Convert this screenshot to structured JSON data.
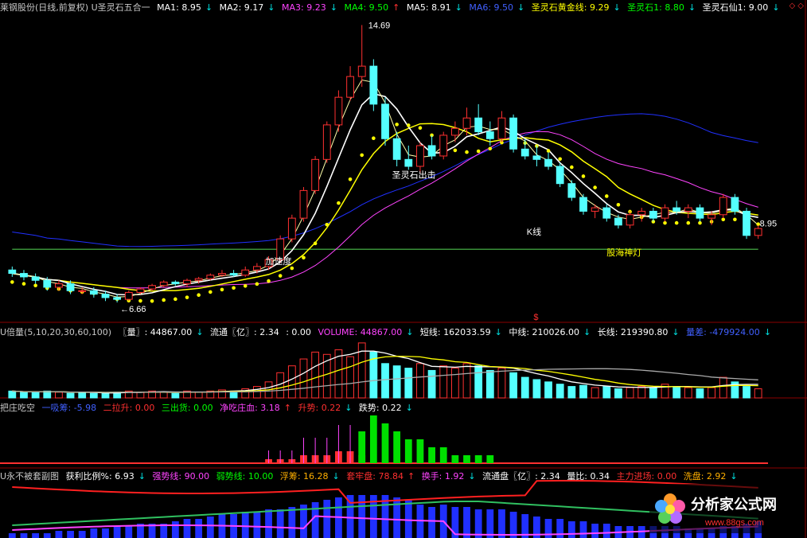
{
  "colors": {
    "bg": "#000000",
    "axis": "#8b0000",
    "up": "#ff3030",
    "down": "#54ffff",
    "white": "#ffffff",
    "yellow": "#ffff00",
    "magenta": "#ff44ff",
    "green": "#4cbf4c",
    "blue": "#2030ff",
    "cyan": "#00e0e0"
  },
  "header": {
    "title": "莱钢股份(日线,前复权) U圣灵石五合一",
    "ma1": "MA1: 8.95",
    "ma2": "MA2: 9.17",
    "ma3": "MA3: 9.23",
    "ma4": "MA4: 9.50",
    "ma5": "MA5: 8.91",
    "ma6": "MA6: 9.50",
    "gold": "圣灵石黄金线: 9.29",
    "stone1": "圣灵石1: 8.80",
    "immortal1": "圣灵石仙1: 9.00"
  },
  "annotations": {
    "high": "14.69",
    "low": "←6.66",
    "last": "8.95",
    "signal_sell": "圣灵石出击",
    "signal_accel": "加速度",
    "signal_k": "K线",
    "signal_lamp": "股海神灯",
    "marker": "$"
  },
  "panel2": {
    "title": "U倍量(5,10,20,30,60,100)",
    "vol": "〖量〗: 44867.00",
    "float": "流通〖亿〗: 2.34",
    "zero": ": 0.00",
    "volume": "VOLUME: 44867.00",
    "short": "短线: 162033.59",
    "mid": "中线: 210026.00",
    "long": "长线: 219390.80",
    "diff": "量差: -479924.00"
  },
  "panel3": {
    "title": "把庄吃空",
    "a": "一吸筹: -5.98",
    "b": "二拉升: 0.00",
    "c": "三出货: 0.00",
    "d": "净吃庄血: 3.18",
    "e": "升势: 0.22",
    "f": "跌势: 0.22"
  },
  "panel4": {
    "title": "U永不被套副图",
    "a": "获利比例%: 6.93",
    "b": "强势线: 90.00",
    "c": "弱势线: 10.00",
    "d": "浮筹: 16.28",
    "e": "套牢盘: 78.84",
    "f": "换手: 1.92",
    "g": "流通盘〖亿〗: 2.34",
    "h": "量比: 0.34",
    "i": "主力进场: 0.00",
    "j": "洗盘: 2.92"
  },
  "watermark": {
    "name": "分析家公式网",
    "url": "www.88gs.com"
  },
  "chart_data": {
    "type": "candlestick",
    "price_range": [
      6.2,
      15.0
    ],
    "candles": [
      [
        7.6,
        7.7,
        7.4,
        7.5
      ],
      [
        7.5,
        7.6,
        7.3,
        7.4
      ],
      [
        7.4,
        7.5,
        7.2,
        7.3
      ],
      [
        7.3,
        7.4,
        7.0,
        7.1
      ],
      [
        7.1,
        7.3,
        7.0,
        7.2
      ],
      [
        7.2,
        7.3,
        6.9,
        7.0
      ],
      [
        7.0,
        7.1,
        6.9,
        7.0
      ],
      [
        7.0,
        7.1,
        6.8,
        6.9
      ],
      [
        6.9,
        7.0,
        6.7,
        6.8
      ],
      [
        6.8,
        6.9,
        6.66,
        6.75
      ],
      [
        6.75,
        7.0,
        6.7,
        6.95
      ],
      [
        6.95,
        7.1,
        6.9,
        7.05
      ],
      [
        7.05,
        7.2,
        7.0,
        7.15
      ],
      [
        7.15,
        7.3,
        7.1,
        7.25
      ],
      [
        7.25,
        7.3,
        7.15,
        7.2
      ],
      [
        7.2,
        7.35,
        7.1,
        7.3
      ],
      [
        7.3,
        7.4,
        7.2,
        7.35
      ],
      [
        7.35,
        7.5,
        7.3,
        7.45
      ],
      [
        7.45,
        7.6,
        7.4,
        7.5
      ],
      [
        7.5,
        7.6,
        7.4,
        7.45
      ],
      [
        7.45,
        7.7,
        7.4,
        7.6
      ],
      [
        7.6,
        7.8,
        7.5,
        7.7
      ],
      [
        7.7,
        8.0,
        7.6,
        7.9
      ],
      [
        7.9,
        8.6,
        7.8,
        8.5
      ],
      [
        8.5,
        9.2,
        8.4,
        9.1
      ],
      [
        9.1,
        10.0,
        9.0,
        9.9
      ],
      [
        9.9,
        10.9,
        9.8,
        10.8
      ],
      [
        10.8,
        11.9,
        10.7,
        11.8
      ],
      [
        11.8,
        12.8,
        11.6,
        12.6
      ],
      [
        12.6,
        13.5,
        12.5,
        13.2
      ],
      [
        13.2,
        14.69,
        12.9,
        13.5
      ],
      [
        13.5,
        13.7,
        12.2,
        12.4
      ],
      [
        12.4,
        12.6,
        11.2,
        11.4
      ],
      [
        11.4,
        11.6,
        10.6,
        10.8
      ],
      [
        10.8,
        11.2,
        10.5,
        10.6
      ],
      [
        10.6,
        11.3,
        10.4,
        11.2
      ],
      [
        11.2,
        11.5,
        10.8,
        10.9
      ],
      [
        10.9,
        11.6,
        10.8,
        11.5
      ],
      [
        11.5,
        11.9,
        11.3,
        11.7
      ],
      [
        11.7,
        12.3,
        11.5,
        12.0
      ],
      [
        12.0,
        12.4,
        11.5,
        11.6
      ],
      [
        11.6,
        11.9,
        11.2,
        11.4
      ],
      [
        11.4,
        12.2,
        11.3,
        12.0
      ],
      [
        12.0,
        12.1,
        11.0,
        11.1
      ],
      [
        11.1,
        11.4,
        10.8,
        10.9
      ],
      [
        10.9,
        11.2,
        10.6,
        10.8
      ],
      [
        10.8,
        11.0,
        10.5,
        10.6
      ],
      [
        10.6,
        10.7,
        10.0,
        10.1
      ],
      [
        10.1,
        10.2,
        9.6,
        9.7
      ],
      [
        9.7,
        9.8,
        9.2,
        9.3
      ],
      [
        9.3,
        9.5,
        9.1,
        9.4
      ],
      [
        9.4,
        9.5,
        9.0,
        9.1
      ],
      [
        9.1,
        9.2,
        8.8,
        8.9
      ],
      [
        8.9,
        9.3,
        8.8,
        9.2
      ],
      [
        9.2,
        9.4,
        9.0,
        9.3
      ],
      [
        9.3,
        9.4,
        9.0,
        9.1
      ],
      [
        9.1,
        9.5,
        9.0,
        9.4
      ],
      [
        9.4,
        9.6,
        9.2,
        9.3
      ],
      [
        9.3,
        9.5,
        9.1,
        9.4
      ],
      [
        9.4,
        9.5,
        9.0,
        9.1
      ],
      [
        9.1,
        9.3,
        8.9,
        9.2
      ],
      [
        9.2,
        9.8,
        9.1,
        9.7
      ],
      [
        9.7,
        9.8,
        9.2,
        9.3
      ],
      [
        9.3,
        9.4,
        8.5,
        8.6
      ],
      [
        8.6,
        8.9,
        8.5,
        8.8
      ]
    ],
    "volume": [
      6,
      5,
      5,
      6,
      5,
      4,
      5,
      4,
      4,
      5,
      6,
      5,
      6,
      5,
      4,
      6,
      5,
      6,
      7,
      6,
      8,
      10,
      14,
      22,
      28,
      34,
      40,
      38,
      42,
      36,
      48,
      40,
      30,
      28,
      26,
      30,
      24,
      28,
      26,
      30,
      28,
      24,
      26,
      22,
      18,
      16,
      14,
      12,
      10,
      11,
      9,
      10,
      8,
      9,
      10,
      9,
      12,
      10,
      9,
      8,
      9,
      18,
      14,
      10,
      8
    ],
    "volume_up": [
      0,
      0,
      0,
      0,
      1,
      0,
      0,
      0,
      0,
      0,
      1,
      1,
      1,
      1,
      0,
      1,
      1,
      1,
      1,
      0,
      1,
      1,
      1,
      1,
      1,
      1,
      1,
      1,
      1,
      1,
      1,
      0,
      0,
      0,
      0,
      1,
      0,
      1,
      1,
      1,
      0,
      0,
      1,
      0,
      0,
      0,
      0,
      0,
      0,
      0,
      1,
      0,
      0,
      1,
      1,
      0,
      1,
      0,
      1,
      0,
      1,
      1,
      0,
      0,
      1
    ],
    "panel3_red": [
      0,
      0,
      0,
      0,
      0,
      0,
      0,
      0,
      0,
      0,
      0,
      0,
      0,
      0,
      0,
      0,
      0,
      0,
      0,
      0,
      0,
      0,
      1,
      1,
      1,
      2,
      2,
      2,
      3,
      3,
      2,
      0,
      0,
      0,
      0,
      0,
      0,
      0,
      0,
      0,
      0,
      0,
      0,
      0,
      0,
      0,
      0,
      0,
      0,
      0,
      0,
      0,
      0,
      0,
      0,
      0,
      0,
      0,
      0,
      0,
      0,
      0,
      0,
      0,
      0
    ],
    "panel3_green": [
      0,
      0,
      0,
      0,
      0,
      0,
      0,
      0,
      0,
      0,
      0,
      0,
      0,
      0,
      0,
      0,
      0,
      0,
      0,
      0,
      0,
      0,
      0,
      0,
      0,
      0,
      0,
      0,
      0,
      0,
      4,
      6,
      5,
      4,
      3,
      3,
      2,
      2,
      1,
      1,
      1,
      1,
      0,
      0,
      0,
      0,
      0,
      0,
      0,
      0,
      0,
      0,
      0,
      0,
      0,
      0,
      0,
      0,
      0,
      0,
      0,
      0,
      0,
      0,
      0
    ],
    "panel4_blue": [
      2,
      2,
      2,
      2,
      3,
      3,
      3,
      4,
      4,
      5,
      5,
      6,
      6,
      6,
      7,
      8,
      8,
      9,
      10,
      10,
      11,
      11,
      12,
      12,
      13,
      14,
      15,
      16,
      17,
      18,
      18,
      18,
      18,
      17,
      16,
      14,
      13,
      14,
      13,
      13,
      12,
      12,
      12,
      11,
      10,
      9,
      8,
      8,
      7,
      7,
      6,
      6,
      5,
      5,
      5,
      5,
      5,
      5,
      4,
      4,
      4,
      5,
      5,
      6,
      7
    ],
    "ma": {
      "values_ref": "computed from candles"
    }
  }
}
